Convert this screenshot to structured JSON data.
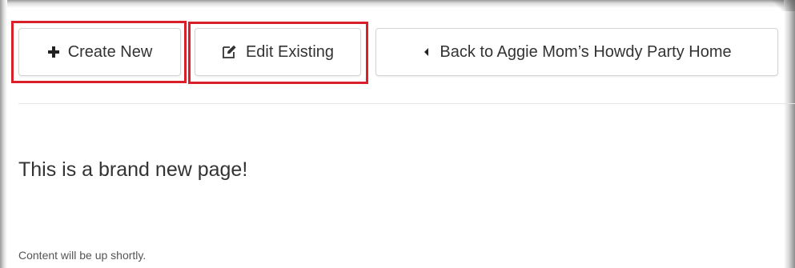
{
  "toolbar": {
    "create_label": "Create New",
    "create_icon": "plus-icon",
    "edit_label": "Edit Existing",
    "edit_icon": "edit-pencil-icon",
    "back_label": "Back to Aggie Mom’s Howdy Party Home",
    "back_icon": "caret-left-icon"
  },
  "content": {
    "heading": "This is a brand new page!",
    "body": "Content will be up shortly."
  },
  "colors": {
    "highlight": "#d9202a",
    "text": "#333333"
  }
}
